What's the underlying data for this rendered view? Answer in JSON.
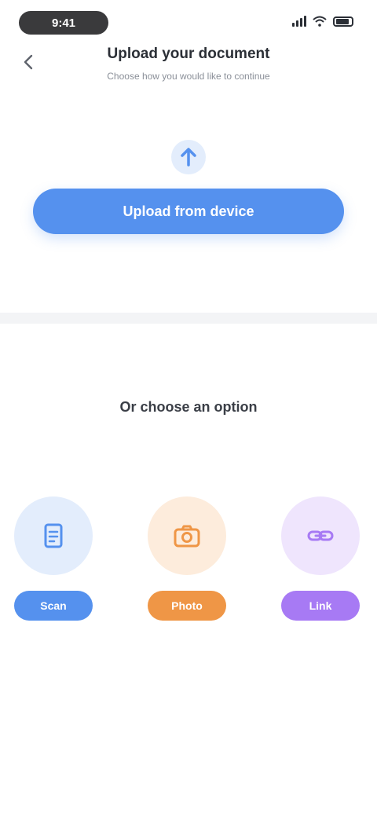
{
  "status_bar": {
    "time": "9:41"
  },
  "header": {
    "title": "Upload your document",
    "subtitle": "Choose how you would like to continue"
  },
  "primary": {
    "button_label": "Upload from device",
    "icon": "upload-icon"
  },
  "section": {
    "title": "Or choose an option"
  },
  "options": [
    {
      "label": "Scan",
      "icon": "document-icon",
      "color": "#5591ee",
      "bg": "#e3edfc"
    },
    {
      "label": "Photo",
      "icon": "camera-icon",
      "color": "#ef9646",
      "bg": "#fdecdc"
    },
    {
      "label": "Link",
      "icon": "link-icon",
      "color": "#a77af4",
      "bg": "#efe5fd"
    }
  ],
  "colors": {
    "accent": "#5591ee",
    "orange": "#ef9646",
    "purple": "#a77af4"
  }
}
